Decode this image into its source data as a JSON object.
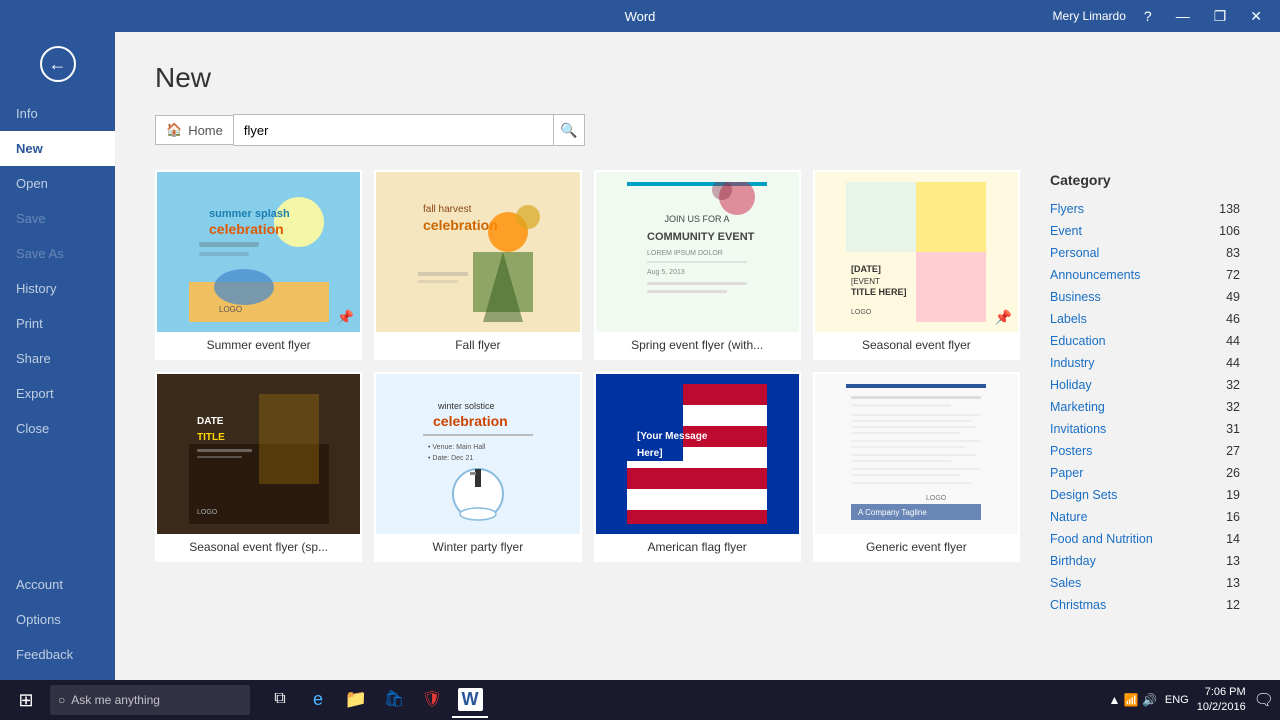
{
  "topbar": {
    "app_name": "Word",
    "user_name": "Mery Limardo",
    "help_label": "?",
    "minimize": "—",
    "restore": "❐",
    "close": "✕"
  },
  "sidebar": {
    "back_icon": "←",
    "items": [
      {
        "id": "info",
        "label": "Info",
        "active": false
      },
      {
        "id": "new",
        "label": "New",
        "active": true
      },
      {
        "id": "open",
        "label": "Open",
        "active": false
      },
      {
        "id": "save",
        "label": "Save",
        "active": false,
        "disabled": true
      },
      {
        "id": "save-as",
        "label": "Save As",
        "active": false,
        "disabled": true
      },
      {
        "id": "history",
        "label": "History",
        "active": false
      },
      {
        "id": "print",
        "label": "Print",
        "active": false
      },
      {
        "id": "share",
        "label": "Share",
        "active": false
      },
      {
        "id": "export",
        "label": "Export",
        "active": false
      },
      {
        "id": "close",
        "label": "Close",
        "active": false
      }
    ],
    "bottom_items": [
      {
        "id": "account",
        "label": "Account"
      },
      {
        "id": "options",
        "label": "Options"
      },
      {
        "id": "feedback",
        "label": "Feedback"
      }
    ]
  },
  "content": {
    "page_title": "New",
    "search": {
      "home_label": "Home",
      "placeholder": "flyer",
      "search_icon": "🔍"
    },
    "templates": [
      {
        "id": "summer",
        "label": "Summer event flyer",
        "pin": true
      },
      {
        "id": "fall",
        "label": "Fall flyer",
        "pin": false
      },
      {
        "id": "spring",
        "label": "Spring event flyer (with...",
        "pin": false
      },
      {
        "id": "seasonal",
        "label": "Seasonal event flyer",
        "pin": true
      },
      {
        "id": "seasonal2",
        "label": "Seasonal event flyer (sp...",
        "pin": false
      },
      {
        "id": "winter",
        "label": "Winter party flyer",
        "pin": false
      },
      {
        "id": "flag",
        "label": "American flag flyer",
        "pin": false
      },
      {
        "id": "generic",
        "label": "Generic event flyer",
        "pin": false
      }
    ]
  },
  "categories": {
    "title": "Category",
    "items": [
      {
        "label": "Flyers",
        "count": 138
      },
      {
        "label": "Event",
        "count": 106
      },
      {
        "label": "Personal",
        "count": 83
      },
      {
        "label": "Announcements",
        "count": 72
      },
      {
        "label": "Business",
        "count": 49
      },
      {
        "label": "Labels",
        "count": 46
      },
      {
        "label": "Education",
        "count": 44
      },
      {
        "label": "Industry",
        "count": 44
      },
      {
        "label": "Holiday",
        "count": 32
      },
      {
        "label": "Marketing",
        "count": 32
      },
      {
        "label": "Invitations",
        "count": 31
      },
      {
        "label": "Posters",
        "count": 27
      },
      {
        "label": "Paper",
        "count": 26
      },
      {
        "label": "Design Sets",
        "count": 19
      },
      {
        "label": "Nature",
        "count": 16
      },
      {
        "label": "Food and Nutrition",
        "count": 14
      },
      {
        "label": "Birthday",
        "count": 13
      },
      {
        "label": "Sales",
        "count": 13
      },
      {
        "label": "Christmas",
        "count": 12
      }
    ]
  },
  "taskbar": {
    "search_placeholder": "Ask me anything",
    "time": "7:06 PM",
    "date": "10/2/2016",
    "language": "ENG"
  }
}
